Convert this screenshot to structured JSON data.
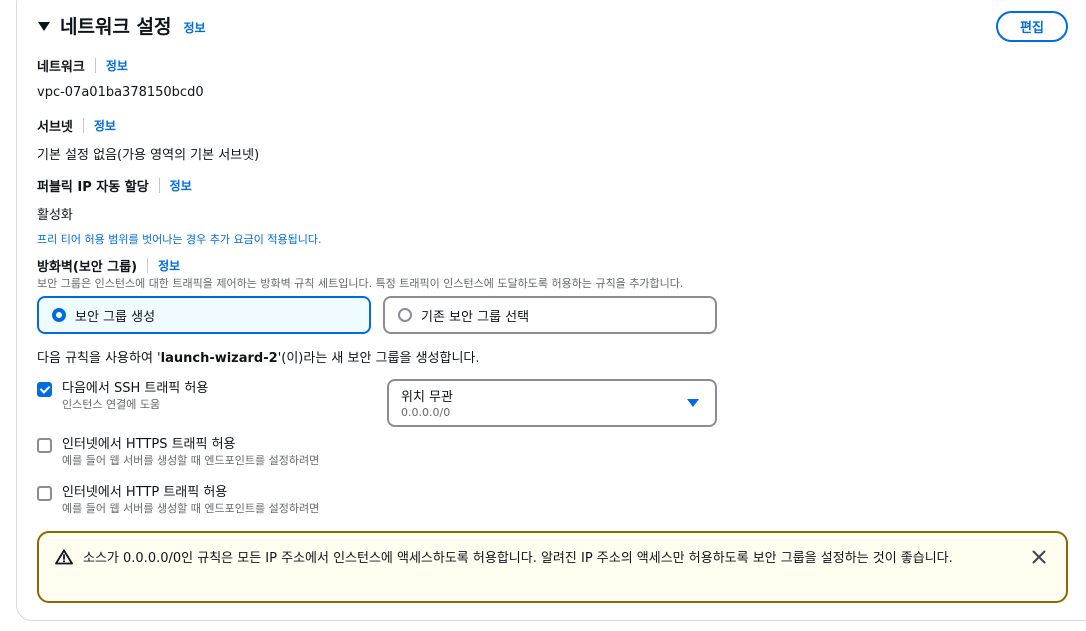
{
  "section": {
    "title": "네트워크 설정",
    "info": "정보",
    "edit_label": "편집"
  },
  "network": {
    "label": "네트워크",
    "info": "정보",
    "value": "vpc-07a01ba378150bcd0"
  },
  "subnet": {
    "label": "서브넷",
    "info": "정보",
    "value": "기본 설정 없음(가용 영역의 기본 서브넷)"
  },
  "public_ip": {
    "label": "퍼블릭 IP 자동 할당",
    "info": "정보",
    "value": "활성화",
    "note": "프리 티어 허용 범위를 벗어나는 경우 추가 요금이 적용됩니다."
  },
  "firewall": {
    "label": "방화벽(보안 그룹)",
    "info": "정보",
    "description": "보안 그룹은 인스턴스에 대한 트래픽을 제어하는 방화벽 규칙 세트입니다. 특정 트래픽이 인스턴스에 도달하도록 허용하는 규칙을 추가합니다.",
    "options": [
      {
        "label": "보안 그룹 생성",
        "selected": true
      },
      {
        "label": "기존 보안 그룹 선택",
        "selected": false
      }
    ],
    "rule_prefix": "다음 규칙을 사용하여 '",
    "rule_group_name": "launch-wizard-2",
    "rule_suffix": "'(이)라는 새 보안 그룹을 생성합니다."
  },
  "rules": [
    {
      "label": "다음에서 SSH 트래픽 허용",
      "sub": "인스턴스 연결에 도움",
      "checked": true
    },
    {
      "label": "인터넷에서 HTTPS 트래픽 허용",
      "sub": "예를 들어 웹 서버를 생성할 때 엔드포인트를 설정하려면",
      "checked": false
    },
    {
      "label": "인터넷에서 HTTP 트래픽 허용",
      "sub": "예를 들어 웹 서버를 생성할 때 엔드포인트를 설정하려면",
      "checked": false
    }
  ],
  "source_select": {
    "value": "위치 무관",
    "sub": "0.0.0.0/0"
  },
  "alert": {
    "text": "소스가 0.0.0.0/0인 규칙은 모든 IP 주소에서 인스턴스에 액세스하도록 허용합니다. 알려진 IP 주소의 액세스만 허용하도록 보안 그룹을 설정하는 것이 좋습니다."
  },
  "colors": {
    "accent": "#006ce0",
    "warning_border": "#8d6605",
    "text": "#0f141a",
    "secondary_text": "#656871"
  }
}
